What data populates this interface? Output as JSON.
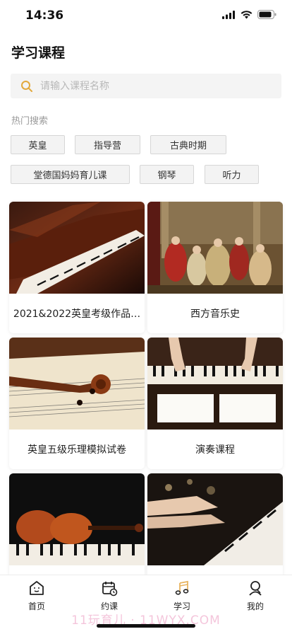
{
  "status_bar": {
    "time": "14:36"
  },
  "page": {
    "title": "学习课程"
  },
  "search": {
    "placeholder": "请输入课程名称"
  },
  "hot_search": {
    "label": "热门搜索",
    "tags": [
      "英皇",
      "指导营",
      "古典时期",
      "堂德国妈妈育儿课",
      "钢琴",
      "听力"
    ]
  },
  "courses": [
    {
      "name": "2021&2022英皇考级作品…",
      "image": "grand-piano-keys"
    },
    {
      "name": "西方音乐史",
      "image": "classical-painting"
    },
    {
      "name": "英皇五级乐理模拟试卷",
      "image": "violin-sheet-music"
    },
    {
      "name": "演奏课程",
      "image": "hands-on-piano"
    },
    {
      "name": "",
      "image": "violin-on-piano"
    },
    {
      "name": "",
      "image": "hands-playing-keys"
    }
  ],
  "tabbar": {
    "items": [
      {
        "label": "首页",
        "icon": "home-icon"
      },
      {
        "label": "约课",
        "icon": "calendar-icon"
      },
      {
        "label": "学习",
        "icon": "music-note-icon",
        "active": true
      },
      {
        "label": "我的",
        "icon": "profile-icon"
      }
    ],
    "accent_color": "#e8b460"
  },
  "watermark": "11玩育儿 · 11WYX.COM"
}
